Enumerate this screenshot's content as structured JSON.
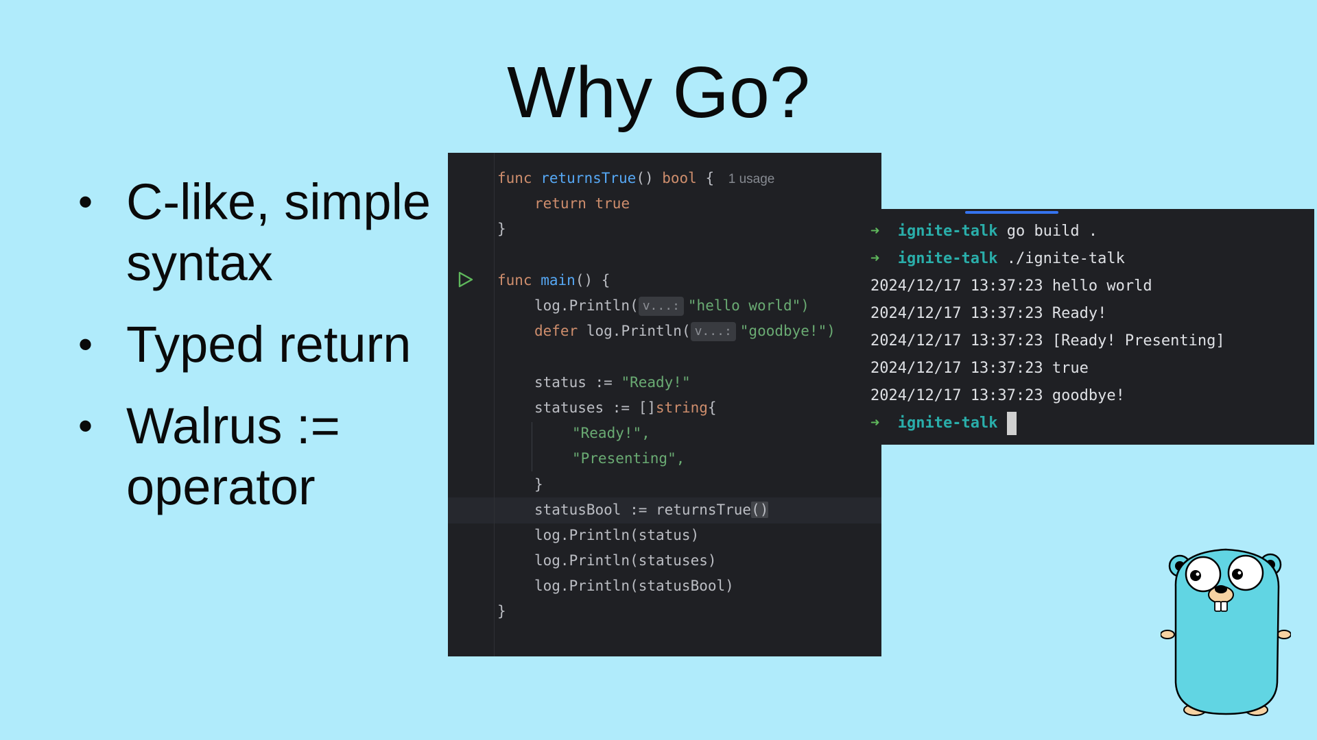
{
  "slide": {
    "title": "Why Go?",
    "bullets": [
      "C-like, simple syntax",
      "Typed return",
      "Walrus := operator"
    ],
    "bullet_glyph": "•"
  },
  "code": {
    "usage_hint": "1 usage",
    "param_hint": "v...:",
    "kw_func": "func",
    "kw_return": "return",
    "kw_true": "true",
    "kw_bool": "bool",
    "kw_defer": "defer",
    "kw_string": "string",
    "fn_returnsTrue": "returnsTrue",
    "fn_main": "main",
    "log_println": "log.Println(",
    "s_hello": "\"hello world\")",
    "s_goodbye": "\"goodbye!\")",
    "status_decl": "status := ",
    "s_ready": "\"Ready!\"",
    "statuses_decl": "statuses := []",
    "s_ready_item": "\"Ready!\",",
    "s_presenting_item": "\"Presenting\",",
    "statusbool_decl": "statusBool := returnsTrue",
    "print_status": "log.Println(status)",
    "print_statuses": "log.Println(statuses)",
    "print_statusbool": "log.Println(statusBool)"
  },
  "terminal": {
    "prompt_arrow": "➜",
    "dir": "ignite-talk",
    "cmd1": "go build .",
    "cmd2": "./ignite-talk",
    "out": [
      "2024/12/17 13:37:23 hello world",
      "2024/12/17 13:37:23 Ready!",
      "2024/12/17 13:37:23 [Ready! Presenting]",
      "2024/12/17 13:37:23 true",
      "2024/12/17 13:37:23 goodbye!"
    ]
  },
  "colors": {
    "background": "#b0ebfb",
    "editor_bg": "#1f2024",
    "keyword": "#cf8e6d",
    "function": "#56a8f5",
    "string": "#6aab73",
    "terminal_dir": "#2aaeaa",
    "gopher_body": "#61d5e3"
  },
  "icons": {
    "run": "run-triangle-icon",
    "mascot": "go-gopher-icon"
  }
}
